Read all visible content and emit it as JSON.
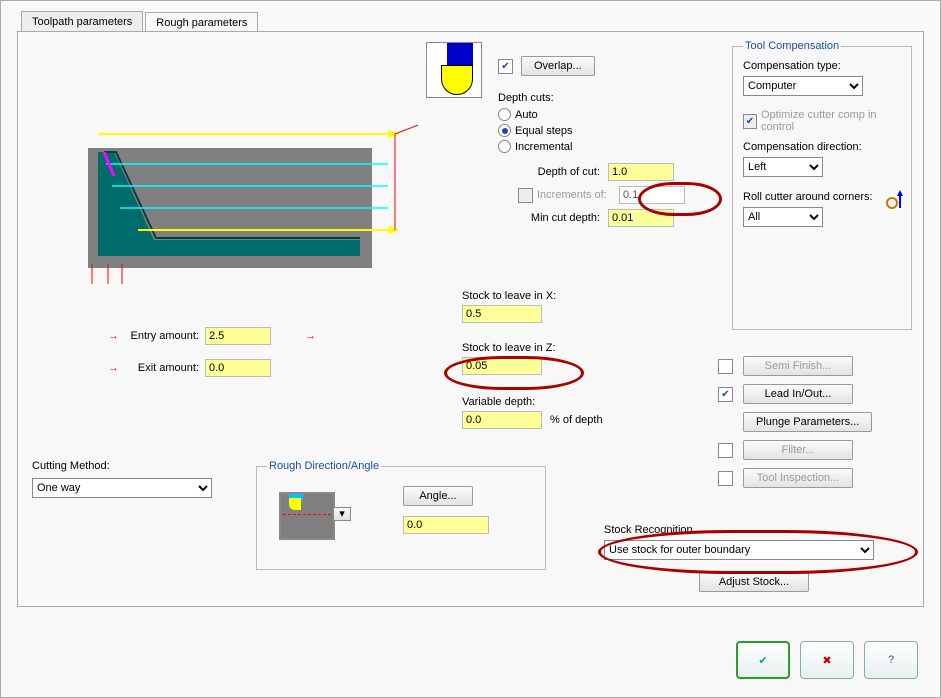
{
  "tabs": {
    "toolpath": "Toolpath parameters",
    "rough": "Rough parameters"
  },
  "overlap": {
    "checked": true,
    "button": "Overlap..."
  },
  "depth_cuts": {
    "title": "Depth cuts:",
    "auto": "Auto",
    "equal": "Equal steps",
    "incremental": "Incremental",
    "selected": "equal",
    "depth_of_cut_label": "Depth of cut:",
    "depth_of_cut": "1.0",
    "increments_label": "Increments of:",
    "increments": "0.1",
    "min_cut_label": "Min cut depth:",
    "min_cut": "0.01"
  },
  "entry": {
    "label": "Entry amount:",
    "value": "2.5"
  },
  "exit": {
    "label": "Exit amount:",
    "value": "0.0"
  },
  "stock_x": {
    "label": "Stock to leave in X:",
    "value": "0.5"
  },
  "stock_z": {
    "label": "Stock to leave in Z:",
    "value": "0.05"
  },
  "var_depth": {
    "label": "Variable depth:",
    "value": "0.0",
    "suffix": "% of depth"
  },
  "tool_comp": {
    "title": "Tool Compensation",
    "type_label": "Compensation type:",
    "type_value": "Computer",
    "optimize": "Optimize cutter comp in control",
    "dir_label": "Compensation direction:",
    "dir_value": "Left",
    "roll_label": "Roll cutter around corners:",
    "roll_value": "All"
  },
  "right_buttons": {
    "semi_finish": "Semi Finish...",
    "lead": "Lead In/Out...",
    "plunge": "Plunge Parameters...",
    "filter": "Filter...",
    "tool_insp": "Tool Inspection..."
  },
  "cutting_method": {
    "label": "Cutting Method:",
    "value": "One way"
  },
  "rough_dir": {
    "title": "Rough Direction/Angle",
    "angle_btn": "Angle...",
    "angle_value": "0.0"
  },
  "stock_recog": {
    "title": "Stock Recognition",
    "value": "Use stock for outer boundary",
    "adjust": "Adjust Stock..."
  },
  "dialog": {
    "ok": "✓",
    "cancel": "✖",
    "help": "?"
  }
}
